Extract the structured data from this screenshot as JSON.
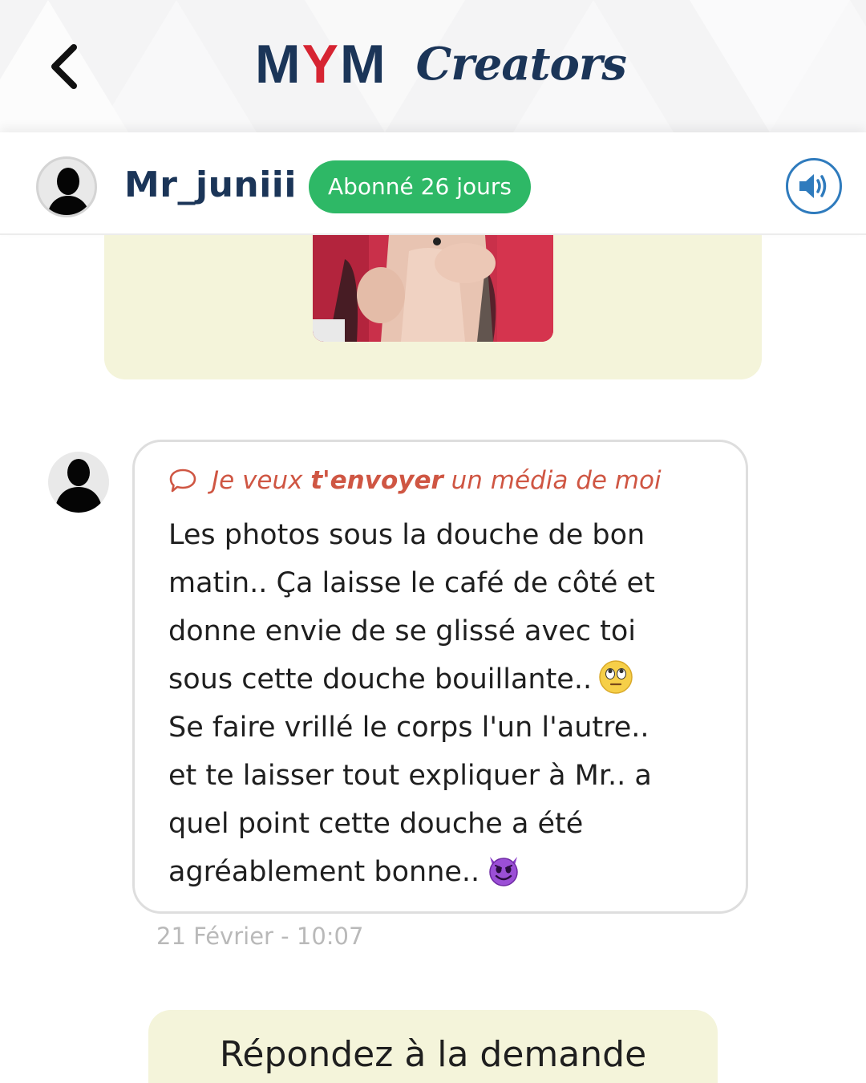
{
  "header": {
    "brand_mym_m1": "M",
    "brand_mym_y": "Y",
    "brand_mym_m2": "M",
    "brand_creators": "Creators"
  },
  "subscriber": {
    "username": "Mr_juniii",
    "badge": "Abonné 26 jours"
  },
  "message": {
    "request_prefix": "Je veux ",
    "request_bold": "t'envoyer",
    "request_suffix": " un média de moi",
    "lines": [
      "Les photos sous la douche de bon",
      "matin.. Ça laisse le café de côté et",
      "donne envie de se glissé avec toi",
      "sous cette douche bouillante..",
      "Se faire vrillé le corps l'un l'autre..",
      "et te laisser tout expliquer à Mr.. a",
      "quel point cette douche a été",
      "agréablement bonne.."
    ],
    "timestamp": "21 Février - 10:07"
  },
  "reply_button": "Répondez à la demande",
  "colors": {
    "brand_navy": "#1b3558",
    "brand_red": "#d62432",
    "badge_green": "#2eb866",
    "request_red": "#cf5643",
    "bubble_cream": "#f4f4da",
    "sound_blue": "#2f7bbd"
  },
  "icons": {
    "back": "chevron-left-icon",
    "sound": "speaker-icon",
    "request": "speech-bubble-icon",
    "emoji_1": "eye-roll-emoji",
    "emoji_2": "smiling-devil-emoji"
  }
}
